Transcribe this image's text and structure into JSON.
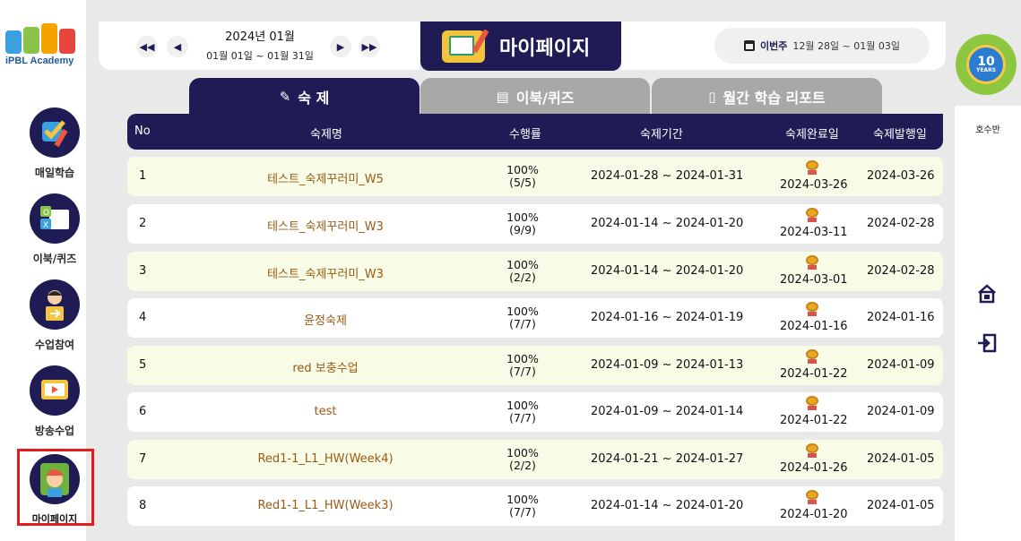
{
  "logo": {
    "text": "iPBL Academy",
    "colors": [
      "#3aa0e0",
      "#8bc34a",
      "#f4a300",
      "#e8453c"
    ]
  },
  "sidebar": {
    "items": [
      {
        "label": "매일학습",
        "icon": "daily-study-icon"
      },
      {
        "label": "이북/퀴즈",
        "icon": "ebook-quiz-icon"
      },
      {
        "label": "수업참여",
        "icon": "class-join-icon"
      },
      {
        "label": "방송수업",
        "icon": "broadcast-icon"
      },
      {
        "label": "마이페이지",
        "icon": "mypage-avatar-icon"
      }
    ],
    "active_index": 4
  },
  "header": {
    "year_month": "2024년 01월",
    "range": "01월 01일 ~ 01월 31일",
    "title": "마이페이지",
    "week_label": "이번주",
    "week_range": "12월 28일 ~ 01월 03일"
  },
  "right_panel": {
    "badge_number": "10",
    "badge_text": "YEARS",
    "class_name": "호수반",
    "home_icon": "home-icon",
    "exit_icon": "logout-icon"
  },
  "tabs": [
    {
      "label": "숙 제",
      "icon": "pencil-icon",
      "active": true
    },
    {
      "label": "이북/퀴즈",
      "icon": "book-icon",
      "active": false
    },
    {
      "label": "월간 학습 리포트",
      "icon": "clipboard-icon",
      "active": false
    }
  ],
  "table": {
    "headers": [
      "No",
      "숙제명",
      "수행률",
      "숙제기간",
      "숙제완료일",
      "숙제발행일"
    ],
    "rows": [
      {
        "no": "1",
        "name": "테스트_숙제꾸러미_W5",
        "rate": "100%",
        "count": "(5/5)",
        "period": "2024-01-28 ~ 2024-01-31",
        "done": "2024-03-26",
        "issued": "2024-03-26"
      },
      {
        "no": "2",
        "name": "테스트_숙제꾸러미_W3",
        "rate": "100%",
        "count": "(9/9)",
        "period": "2024-01-14 ~ 2024-01-20",
        "done": "2024-03-11",
        "issued": "2024-02-28"
      },
      {
        "no": "3",
        "name": "테스트_숙제꾸러미_W3",
        "rate": "100%",
        "count": "(2/2)",
        "period": "2024-01-14 ~ 2024-01-20",
        "done": "2024-03-01",
        "issued": "2024-02-28"
      },
      {
        "no": "4",
        "name": "윤정숙제",
        "rate": "100%",
        "count": "(7/7)",
        "period": "2024-01-16 ~ 2024-01-19",
        "done": "2024-01-16",
        "issued": "2024-01-16"
      },
      {
        "no": "5",
        "name": "red 보충수업",
        "rate": "100%",
        "count": "(7/7)",
        "period": "2024-01-09 ~ 2024-01-13",
        "done": "2024-01-22",
        "issued": "2024-01-09"
      },
      {
        "no": "6",
        "name": "test",
        "rate": "100%",
        "count": "(7/7)",
        "period": "2024-01-09 ~ 2024-01-14",
        "done": "2024-01-22",
        "issued": "2024-01-09"
      },
      {
        "no": "7",
        "name": "Red1-1_L1_HW(Week4)",
        "rate": "100%",
        "count": "(2/2)",
        "period": "2024-01-21 ~ 2024-01-27",
        "done": "2024-01-26",
        "issued": "2024-01-05"
      },
      {
        "no": "8",
        "name": "Red1-1_L1_HW(Week3)",
        "rate": "100%",
        "count": "(7/7)",
        "period": "2024-01-14 ~ 2024-01-20",
        "done": "2024-01-20",
        "issued": "2024-01-05"
      }
    ]
  },
  "colors": {
    "navy": "#1f1c55",
    "highlight_red": "#e11a1a",
    "row_tint": "#f8fbe6",
    "name_text": "#9a5a12"
  }
}
